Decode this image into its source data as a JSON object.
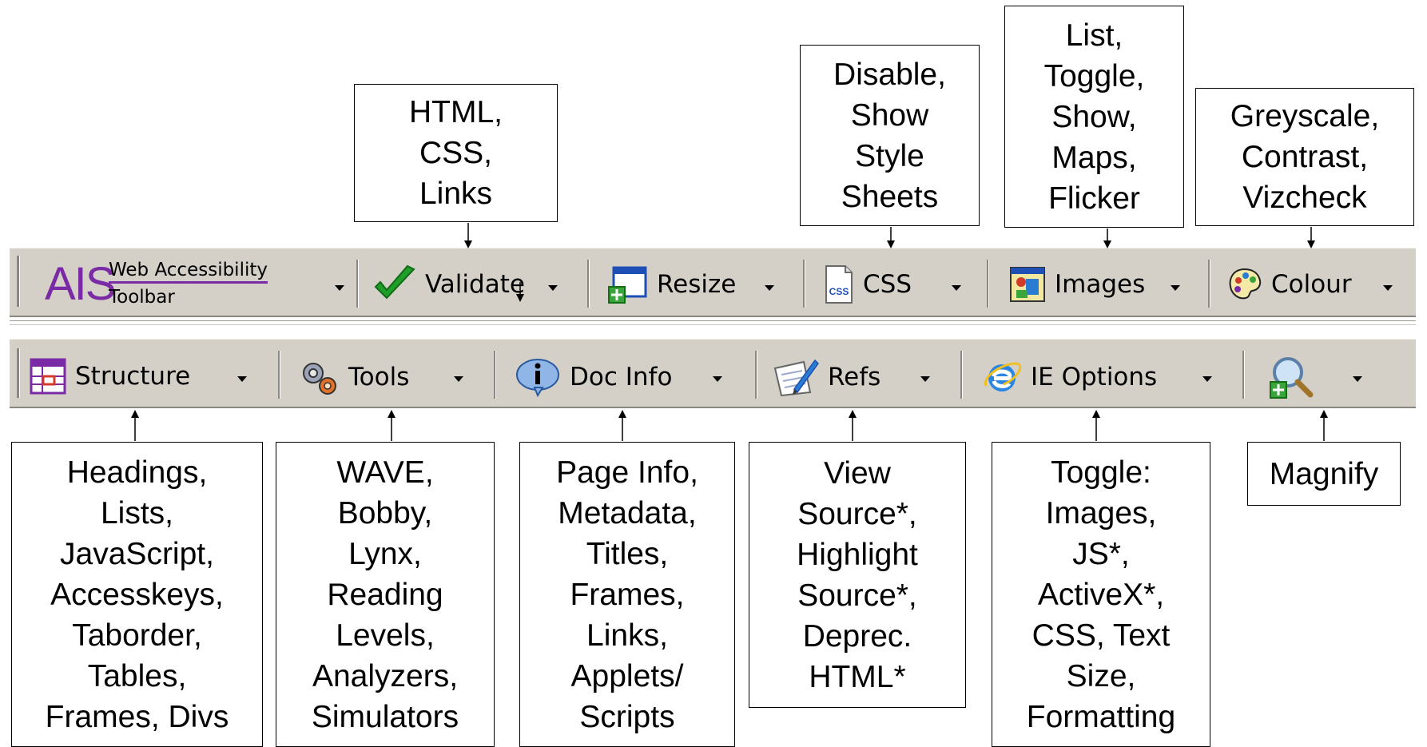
{
  "toolbar_top": {
    "logo": {
      "mark": "AIS",
      "line1": "Web Accessibility",
      "line2": "Toolbar"
    },
    "items": [
      {
        "label": "Validate",
        "icon": "checkmark-icon"
      },
      {
        "label": "Resize",
        "icon": "resize-window-icon"
      },
      {
        "label": "CSS",
        "icon": "css-file-icon"
      },
      {
        "label": "Images",
        "icon": "images-icon"
      },
      {
        "label": "Colour",
        "icon": "colour-palette-icon"
      }
    ]
  },
  "toolbar_bottom": {
    "items": [
      {
        "label": "Structure",
        "icon": "structure-icon"
      },
      {
        "label": "Tools",
        "icon": "gears-icon"
      },
      {
        "label": "Doc Info",
        "icon": "info-icon"
      },
      {
        "label": "Refs",
        "icon": "refs-pencil-icon"
      },
      {
        "label": "IE Options",
        "icon": "ie-logo-icon"
      },
      {
        "label": "",
        "icon": "magnify-icon"
      }
    ]
  },
  "callouts_top": [
    {
      "text": "HTML,\nCSS,\nLinks"
    },
    {
      "text": "Disable,\nShow\nStyle\nSheets"
    },
    {
      "text": "List,\nToggle,\nShow,\nMaps,\nFlicker"
    },
    {
      "text": "Greyscale,\nContrast,\nVizcheck"
    }
  ],
  "callouts_bottom": [
    {
      "text": "Headings,\nLists,\nJavaScript,\nAccesskeys,\nTaborder,\nTables,\nFrames, Divs"
    },
    {
      "text": "WAVE,\nBobby,\nLynx,\nReading\nLevels,\nAnalyzers,\nSimulators"
    },
    {
      "text": "Page Info,\nMetadata,\nTitles,\nFrames,\nLinks,\nApplets/\nScripts"
    },
    {
      "text": "View\nSource*,\nHighlight\nSource*,\nDeprec.\nHTML*"
    },
    {
      "text": "Toggle:\nImages,\nJS*,\nActiveX*,\nCSS, Text\nSize,\nFormatting"
    },
    {
      "text": "Magnify"
    }
  ]
}
